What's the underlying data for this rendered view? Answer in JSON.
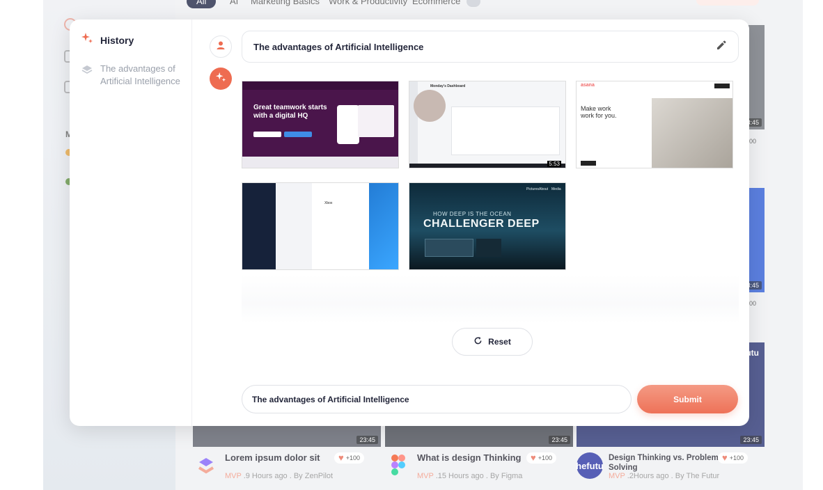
{
  "background": {
    "filters": [
      "All",
      "AI",
      "Marketing Basics",
      "Work & Productivity",
      "Ecommerce"
    ],
    "side_numbers": [
      "00",
      "00"
    ],
    "thumb_badges": [
      "23:45",
      "23:45",
      "23:45",
      "23:45",
      "23:45"
    ],
    "video_cards": [
      {
        "title": "Lorem ipsum dolor sit",
        "mvp": "MVP",
        "meta": " .9 Hours ago . By  ZenPilot",
        "likes": "+100"
      },
      {
        "title": "What is design Thinking",
        "mvp": "MVP",
        "meta": " .15 Hours ago . By  Figma",
        "likes": "+100"
      },
      {
        "title": "Design Thinking vs. Problem Solving",
        "mvp": "MVP",
        "meta": " .2Hours ago . By  The Futur",
        "likes": "+100"
      }
    ],
    "futur_logo_text": "hefutu",
    "futur_top_text": "futu"
  },
  "sidebar": {
    "history_title": "History",
    "items": [
      {
        "label": "The advantages of Artificial Intelligence"
      }
    ]
  },
  "chat": {
    "query": "The advantages of Artificial Intelligence",
    "results": [
      {
        "name": "slack-result",
        "headline": "Great teamwork starts with a digital HQ"
      },
      {
        "name": "monday-result",
        "headline": "Monday's Dashboard",
        "badge": "5:53"
      },
      {
        "name": "asana-result",
        "headline": "Make work work for you.",
        "brand": "asana"
      },
      {
        "name": "windows-app-result",
        "headline": "Xbox"
      },
      {
        "name": "ocean-result",
        "headline": "HOW DEEP IS THE OCEAN",
        "subheadline": "CHALLENGER DEEP",
        "nav": [
          "Pictures",
          "About",
          "Media"
        ]
      }
    ],
    "reset_label": "Reset",
    "input_value": "The advantages of Artificial Intelligence",
    "submit_label": "Submit"
  },
  "colors": {
    "accent": "#ee6c51",
    "navy": "#151b3d",
    "muted": "#9aa0ab"
  },
  "icons": [
    "sparkle-icon",
    "layers-icon",
    "user-icon",
    "edit-icon",
    "refresh-icon",
    "heart-icon"
  ]
}
